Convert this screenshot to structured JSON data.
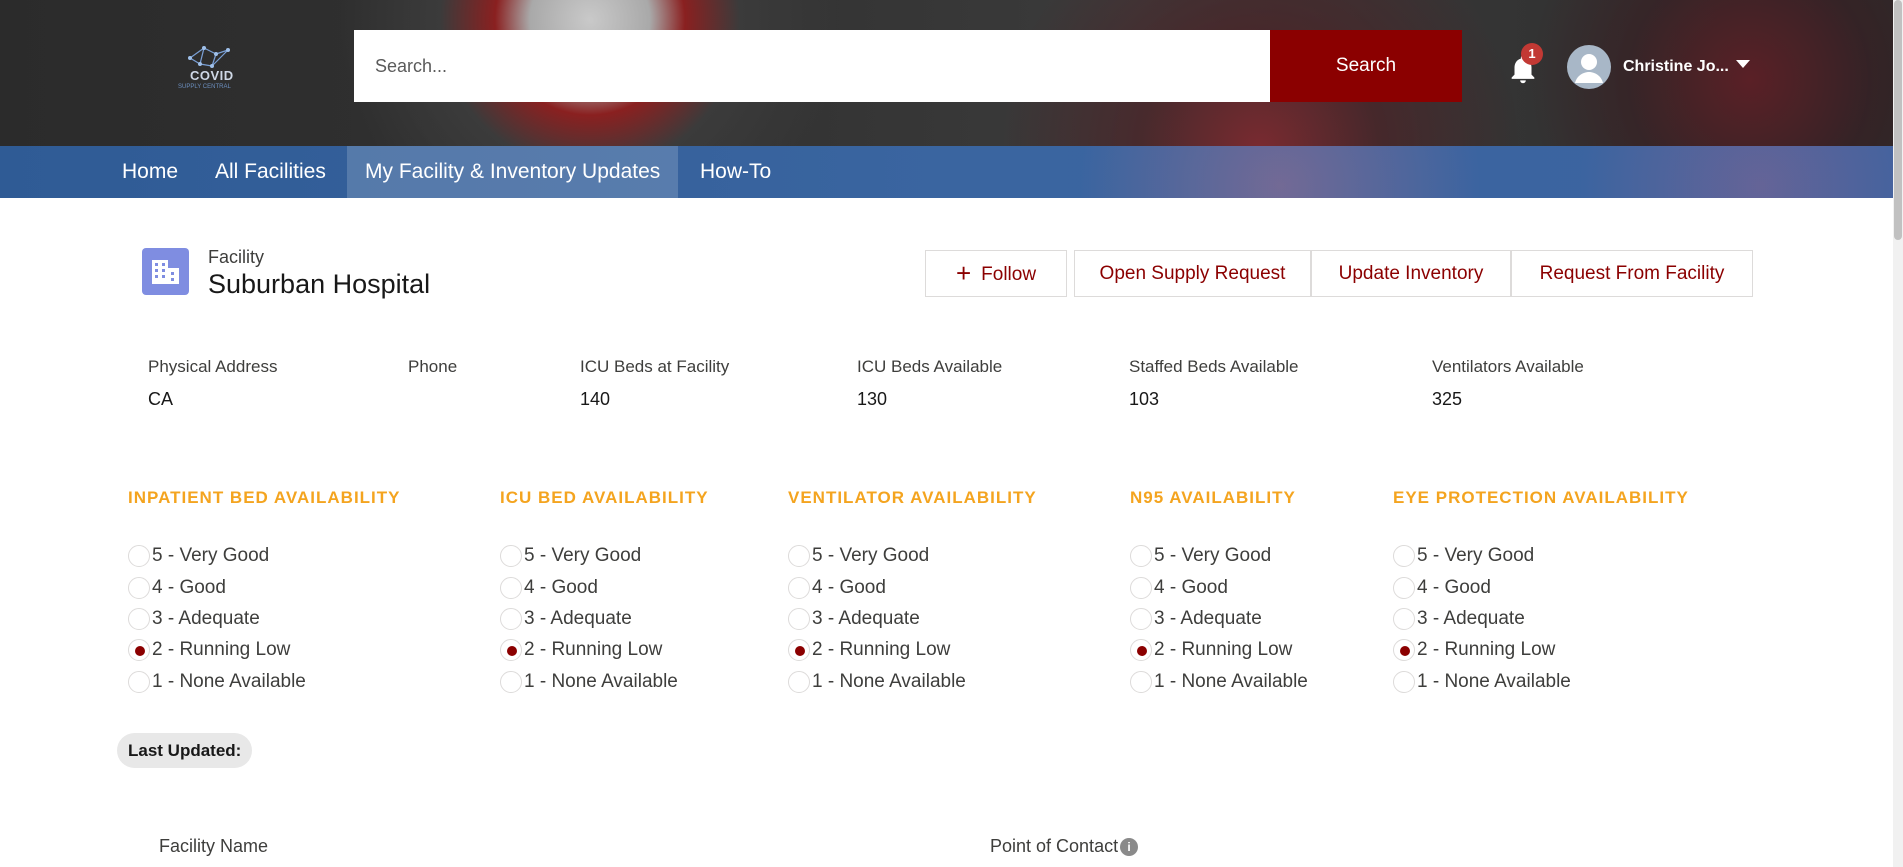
{
  "header": {
    "logo_text": "COVID",
    "logo_subtext": "SUPPLY CENTRAL",
    "search_placeholder": "Search...",
    "search_button": "Search",
    "notification_count": "1",
    "user_name": "Christine Jo..."
  },
  "nav": {
    "items": [
      {
        "label": "Home",
        "active": false
      },
      {
        "label": "All Facilities",
        "active": false
      },
      {
        "label": "My Facility & Inventory Updates",
        "active": true
      },
      {
        "label": "How-To",
        "active": false
      }
    ]
  },
  "facility": {
    "label": "Facility",
    "name": "Suburban Hospital",
    "actions": {
      "follow": "Follow",
      "open_supply_request": "Open Supply Request",
      "update_inventory": "Update Inventory",
      "request_from_facility": "Request From Facility"
    },
    "fields": [
      {
        "label": "Physical Address",
        "value": "CA"
      },
      {
        "label": "Phone",
        "value": ""
      },
      {
        "label": "ICU Beds at Facility",
        "value": "140"
      },
      {
        "label": "ICU Beds Available",
        "value": "130"
      },
      {
        "label": "Staffed Beds Available",
        "value": "103"
      },
      {
        "label": "Ventilators Available",
        "value": "325"
      }
    ]
  },
  "availability": {
    "options": [
      "5 - Very Good",
      "4 - Good",
      "3 - Adequate",
      "2 - Running Low",
      "1 - None Available"
    ],
    "groups": [
      {
        "title": "INPATIENT BED AVAILABILITY",
        "selected": "2 - Running Low"
      },
      {
        "title": "ICU BED AVAILABILITY",
        "selected": "2 - Running Low"
      },
      {
        "title": "VENTILATOR AVAILABILITY",
        "selected": "2 - Running Low"
      },
      {
        "title": "N95 AVAILABILITY",
        "selected": "2 - Running Low"
      },
      {
        "title": "EYE PROTECTION AVAILABILITY",
        "selected": "2 - Running Low"
      }
    ]
  },
  "last_updated_label": "Last Updated:",
  "bottom": {
    "facility_name_label": "Facility Name",
    "point_of_contact_label": "Point of Contact"
  },
  "colors": {
    "brand_red": "#8b0000",
    "accent_orange": "#f4a41f",
    "nav_blue": "#3a65a0"
  }
}
